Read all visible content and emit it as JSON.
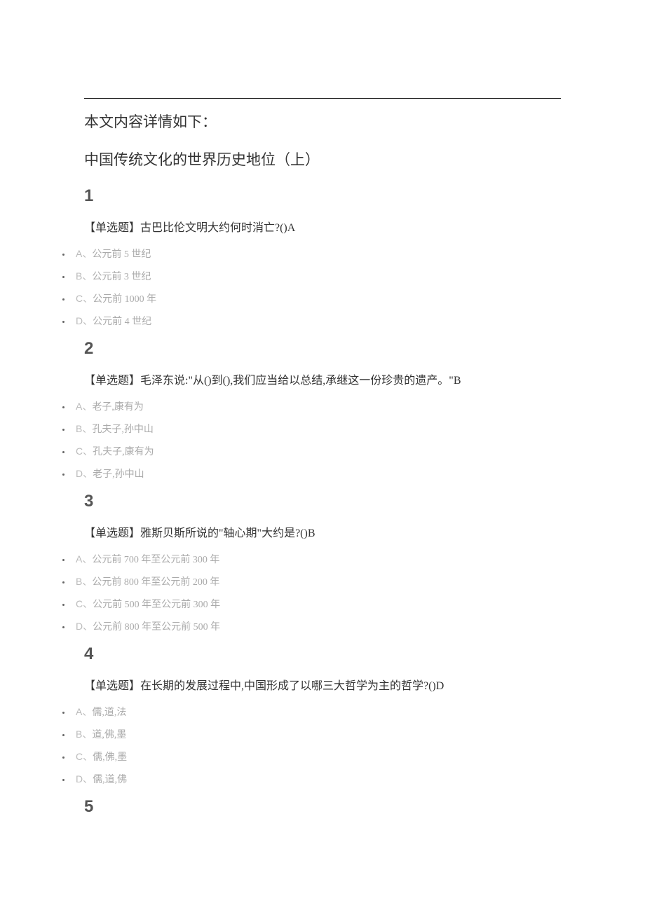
{
  "intro": "本文内容详情如下：",
  "subtitle": "中国传统文化的世界历史地位（上）",
  "questions": [
    {
      "num": "1",
      "text": "【单选题】古巴比伦文明大约何时消亡?()A",
      "options": [
        {
          "letter": "A",
          "text": "公元前 5 世纪"
        },
        {
          "letter": "B",
          "text": "公元前 3 世纪"
        },
        {
          "letter": "C",
          "text": "公元前 1000 年"
        },
        {
          "letter": "D",
          "text": "公元前 4 世纪"
        }
      ]
    },
    {
      "num": "2",
      "text": "【单选题】毛泽东说:\"从()到(),我们应当给以总结,承继这一份珍贵的遗产。\"B",
      "options": [
        {
          "letter": "A",
          "text": "老子,康有为"
        },
        {
          "letter": "B",
          "text": "孔夫子,孙中山"
        },
        {
          "letter": "C",
          "text": "孔夫子,康有为"
        },
        {
          "letter": "D",
          "text": "老子,孙中山"
        }
      ]
    },
    {
      "num": "3",
      "text": "【单选题】雅斯贝斯所说的\"轴心期\"大约是?()B",
      "options": [
        {
          "letter": "A",
          "text": "公元前 700 年至公元前 300 年"
        },
        {
          "letter": "B",
          "text": "公元前 800 年至公元前 200 年"
        },
        {
          "letter": "C",
          "text": "公元前 500 年至公元前 300 年"
        },
        {
          "letter": "D",
          "text": "公元前 800 年至公元前 500 年"
        }
      ]
    },
    {
      "num": "4",
      "text": "【单选题】在长期的发展过程中,中国形成了以哪三大哲学为主的哲学?()D",
      "options": [
        {
          "letter": "A",
          "text": "儒,道,法"
        },
        {
          "letter": "B",
          "text": "道,佛,墨"
        },
        {
          "letter": "C",
          "text": "儒,佛,墨"
        },
        {
          "letter": "D",
          "text": "儒,道,佛"
        }
      ]
    },
    {
      "num": "5",
      "text": "",
      "options": []
    }
  ]
}
